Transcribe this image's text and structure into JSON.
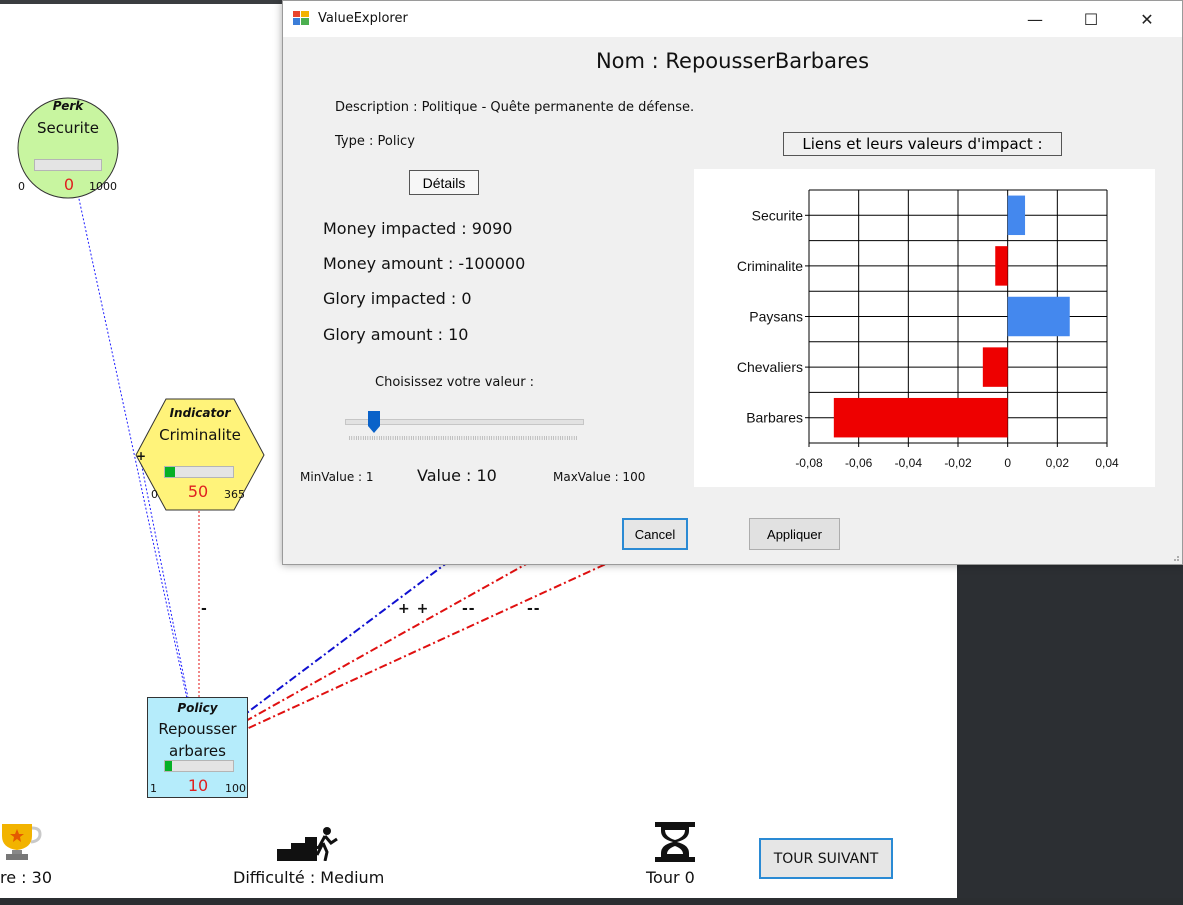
{
  "canvas": {
    "nodes": {
      "perk": {
        "kind": "Perk",
        "name": "Securite",
        "value": "0",
        "min": "0",
        "max": "1000",
        "progress": 0.0
      },
      "indicator": {
        "kind": "Indicator",
        "name": "Criminalite",
        "value": "50",
        "min": "0",
        "max": "365",
        "progress": 0.14
      },
      "policy": {
        "kind": "Policy",
        "name_line1": "Repousser",
        "name_line2": "arbares",
        "value": "10",
        "min": "1",
        "max": "100",
        "progress": 0.1
      }
    },
    "link_signs": {
      "minus": "-",
      "plus_plus": "+ +",
      "minus_minus_1": "-- ",
      "minus_minus_2": "-- "
    },
    "link_colors": {
      "positive": "#1010d0",
      "negative": "#e01010",
      "perk_link": "#2020ff"
    }
  },
  "bottom_bar": {
    "score": "re : 30",
    "difficulty": "Difficulté : Medium",
    "turn": "Tour 0",
    "next_button": "TOUR SUIVANT",
    "icons": [
      "trophy-icon",
      "stairs-climber-icon",
      "hourglass-icon"
    ]
  },
  "dialog": {
    "window_title": "ValueExplorer",
    "window_buttons": {
      "minimize": "—",
      "maximize": "☐",
      "close": "✕"
    },
    "name": "Nom : RepousserBarbares",
    "description": "Description : Politique - Quête permanente de défense.",
    "type": "Type : Policy",
    "details_button": "Détails",
    "money_impacted": "Money impacted : 9090",
    "money_amount": "Money amount : -100000",
    "glory_impacted": "Glory impacted : 0",
    "glory_amount": "Glory amount : 10",
    "slider_prompt": "Choisissez votre valeur :",
    "slider_value_fraction": 0.1,
    "min_value": "MinValue : 1",
    "value": "Value : 10",
    "max_value": "MaxValue : 100",
    "links_title": "Liens et leurs valeurs d'impact :",
    "cancel_button": "Cancel",
    "apply_button": "Appliquer"
  },
  "chart_data": {
    "type": "bar",
    "orientation": "horizontal",
    "categories": [
      "Securite",
      "Criminalite",
      "Paysans",
      "Chevaliers",
      "Barbares"
    ],
    "values": [
      0.007,
      -0.005,
      0.025,
      -0.01,
      -0.07
    ],
    "colors": [
      "#4488ee",
      "#ee0000",
      "#4488ee",
      "#ee0000",
      "#ee0000"
    ],
    "positive_color": "#4488ee",
    "negative_color": "#ee0000",
    "xlim": [
      -0.08,
      0.04
    ],
    "xticks": [
      -0.08,
      -0.06,
      -0.04,
      -0.02,
      0,
      0.02,
      0.04
    ],
    "xtick_labels": [
      "-0,08",
      "-0,06",
      "-0,04",
      "-0,02",
      "0",
      "0,02",
      "0,04"
    ],
    "grid": true,
    "title": "",
    "xlabel": "",
    "ylabel": ""
  }
}
